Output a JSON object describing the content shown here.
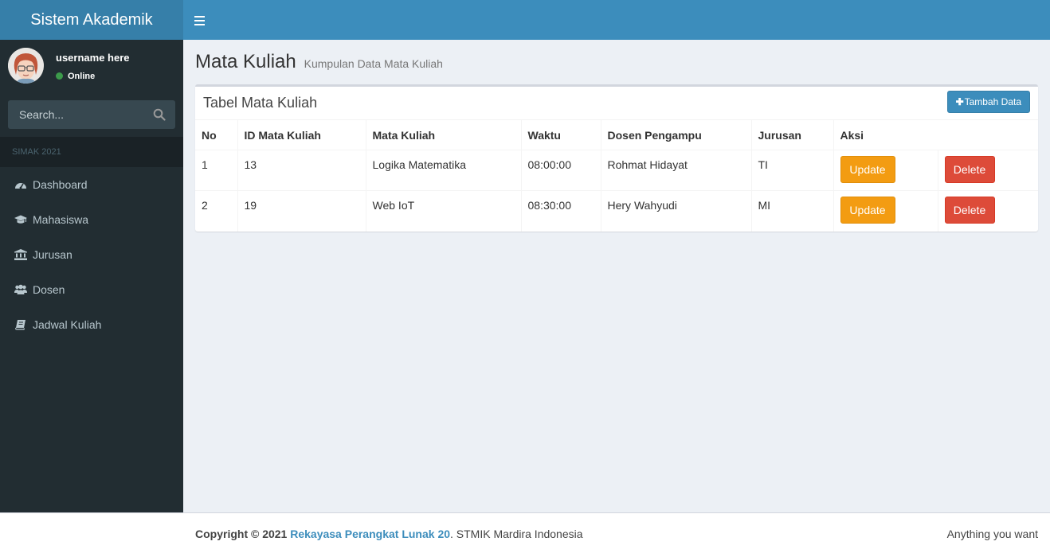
{
  "app": {
    "title": "Sistem Akademik"
  },
  "user": {
    "name": "username here",
    "status": "Online"
  },
  "search": {
    "placeholder": "Search..."
  },
  "sidebar": {
    "header": "SIMAK 2021",
    "items": [
      {
        "label": "Dashboard",
        "icon": "dashboard-icon"
      },
      {
        "label": "Mahasiswa",
        "icon": "graduation-cap-icon"
      },
      {
        "label": "Jurusan",
        "icon": "institution-icon"
      },
      {
        "label": "Dosen",
        "icon": "users-icon"
      },
      {
        "label": "Jadwal Kuliah",
        "icon": "book-icon"
      }
    ]
  },
  "page": {
    "title": "Mata Kuliah",
    "subtitle": "Kumpulan Data Mata Kuliah"
  },
  "box": {
    "title": "Tabel Mata Kuliah",
    "add_label": "Tambah Data"
  },
  "table": {
    "headers": [
      "No",
      "ID Mata Kuliah",
      "Mata Kuliah",
      "Waktu",
      "Dosen Pengampu",
      "Jurusan",
      "Aksi"
    ],
    "rows": [
      {
        "no": "1",
        "id": "13",
        "mata_kuliah": "Logika Matematika",
        "waktu": "08:00:00",
        "dosen": "Rohmat Hidayat",
        "jurusan": "TI",
        "update": "Update",
        "delete": "Delete"
      },
      {
        "no": "2",
        "id": "19",
        "mata_kuliah": "Web IoT",
        "waktu": "08:30:00",
        "dosen": "Hery Wahyudi",
        "jurusan": "MI",
        "update": "Update",
        "delete": "Delete"
      }
    ]
  },
  "footer": {
    "copyright": "Copyright © 2021",
    "link": "Rekayasa Perangkat Lunak 20",
    "org": ". STMIK Mardira Indonesia",
    "right": "Anything you want"
  },
  "colors": {
    "header": "#3c8dbc",
    "logo": "#367fa9",
    "sidebar": "#222d32",
    "update": "#f39c12",
    "delete": "#dd4b39",
    "online": "#3c9a4b"
  }
}
